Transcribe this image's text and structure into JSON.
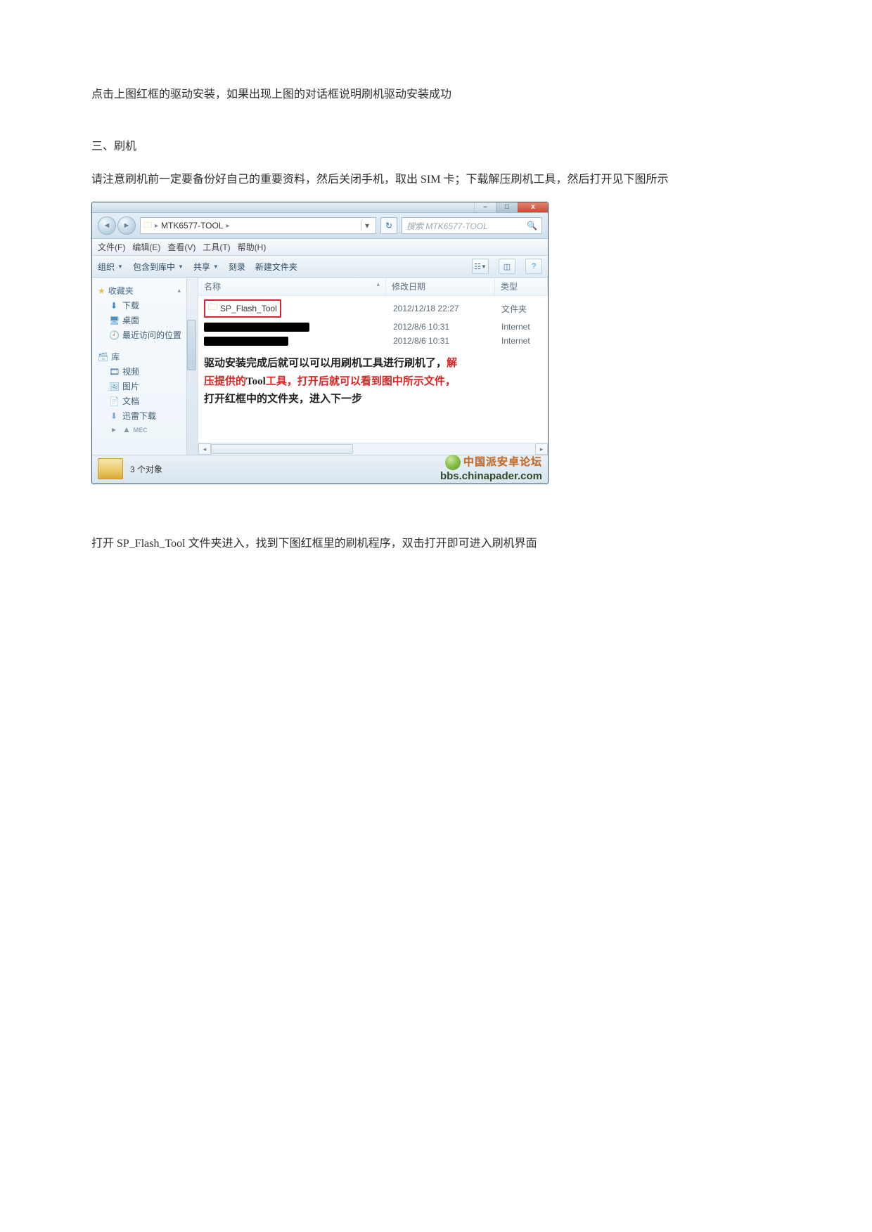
{
  "doc": {
    "p1": "点击上图红框的驱动安装，如果出现上图的对话框说明刷机驱动安装成功",
    "section_title": "三、刷机",
    "p2": "请注意刷机前一定要备份好自己的重要资料，然后关闭手机，取出 SIM 卡；下载解压刷机工具，然后打开见下图所示",
    "p3": "打开 SP_Flash_Tool 文件夹进入，找到下图红框里的刷机程序，双击打开即可进入刷机界面"
  },
  "explorer": {
    "window_buttons": {
      "min": "–",
      "max": "□",
      "close": "x"
    },
    "breadcrumb": {
      "folder": "MTK6577-TOOL"
    },
    "search_placeholder": "搜索 MTK6577-TOOL",
    "menubar": {
      "file": "文件(F)",
      "edit": "编辑(E)",
      "view": "查看(V)",
      "tools": "工具(T)",
      "help": "帮助(H)"
    },
    "toolbar": {
      "organize": "组织",
      "include": "包含到库中",
      "share": "共享",
      "burn": "刻录",
      "newfolder": "新建文件夹"
    },
    "sidebar": {
      "favorites": "收藏夹",
      "fav_items": {
        "downloads": "下载",
        "desktop": "桌面",
        "recent": "最近访问的位置"
      },
      "libraries": "库",
      "lib_items": {
        "videos": "视频",
        "pictures": "图片",
        "documents": "文档",
        "xunlei": "迅雷下载"
      },
      "truncated": "▲ ᴍᴇᴄ"
    },
    "columns": {
      "name": "名称",
      "date": "修改日期",
      "type": "类型"
    },
    "rows": [
      {
        "name": "SP_Flash_Tool",
        "date": "2012/12/18 22:27",
        "type": "文件夹",
        "highlight": true
      },
      {
        "name": "",
        "date": "2012/8/6 10:31",
        "type": "Internet",
        "redact": true
      },
      {
        "name": "",
        "date": "2012/8/6 10:31",
        "type": "Internet",
        "redact": true
      }
    ],
    "overlay": {
      "l1a": "驱动安装完成后就可以可以用刷机工具进行刷机了，",
      "l1b": "解",
      "l2a": "压提供的",
      "l2b": "Tool",
      "l2c": "工具，打开后就可以看到图中所示文件，",
      "l3": "打开红框中的文件夹，进入下一步"
    },
    "status": "3 个对象",
    "watermark": {
      "cn": "中国派安卓论坛",
      "en": "bbs.chinapader.com"
    }
  }
}
